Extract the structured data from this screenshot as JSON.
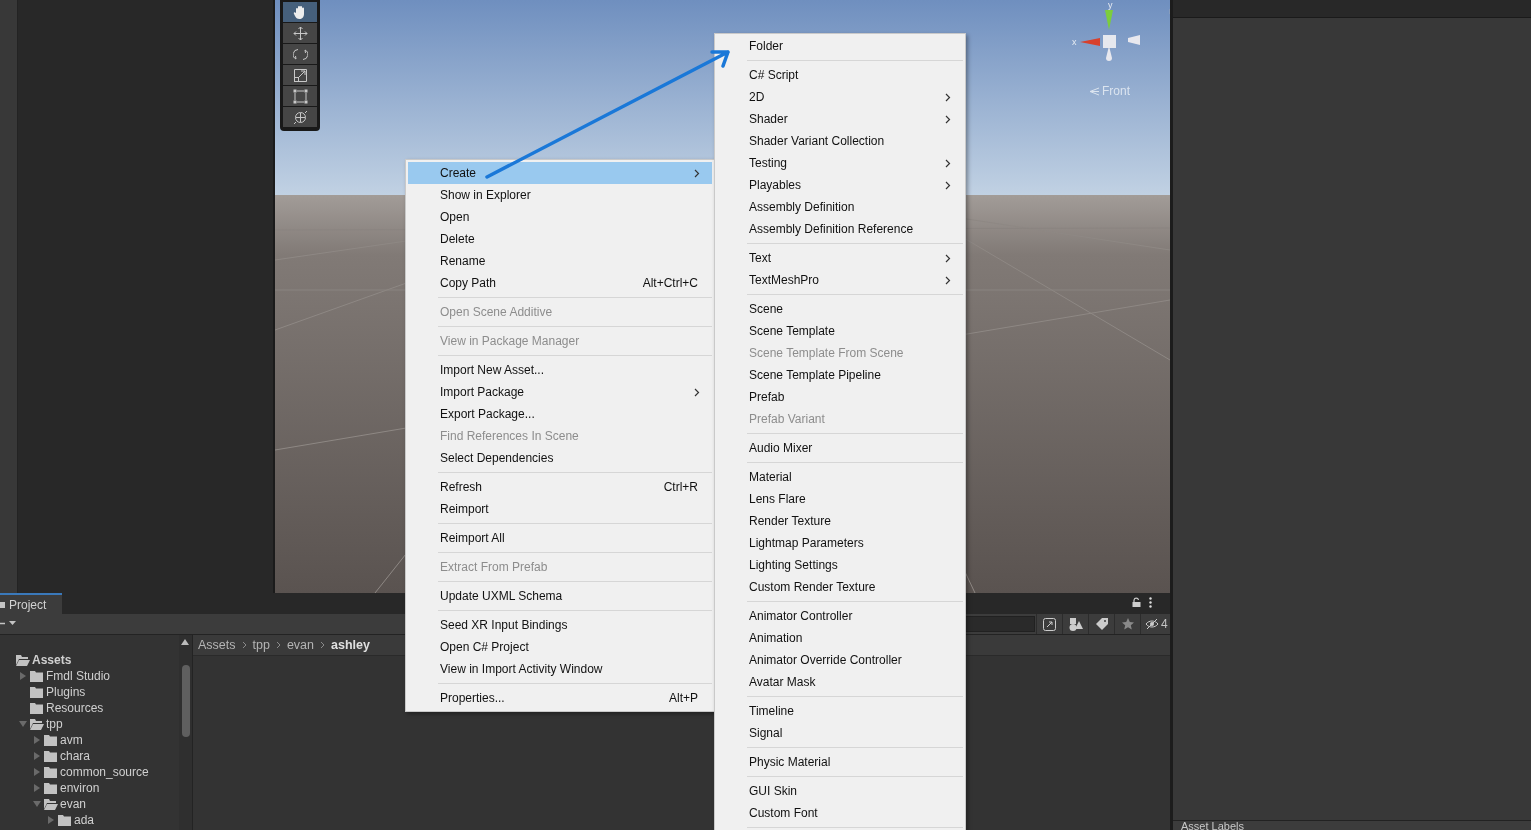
{
  "scene_toolbar": {
    "tools": [
      {
        "kind": "hand",
        "selected": true
      },
      {
        "kind": "move",
        "selected": false
      },
      {
        "kind": "rotate",
        "selected": false
      },
      {
        "kind": "scale",
        "selected": false
      },
      {
        "kind": "rect",
        "selected": false
      },
      {
        "kind": "transform",
        "selected": false
      }
    ]
  },
  "scene_gizmo": {
    "y_label": "y",
    "x_label": "x",
    "view_label": "Front"
  },
  "project_panel": {
    "tabs": [
      {
        "label": "Project",
        "selected": true
      }
    ],
    "item_count": "4",
    "tree": [
      {
        "label": "Assets",
        "kind": "root",
        "expanded": true,
        "children": [
          {
            "label": "Fmdl Studio",
            "kind": "branch",
            "expanded": false
          },
          {
            "label": "Plugins",
            "kind": "leaf",
            "expanded": false
          },
          {
            "label": "Resources",
            "kind": "leaf",
            "expanded": false
          },
          {
            "label": "tpp",
            "kind": "branch",
            "expanded": true,
            "children": [
              {
                "label": "avm",
                "kind": "branch",
                "expanded": false
              },
              {
                "label": "chara",
                "kind": "branch",
                "expanded": false
              },
              {
                "label": "common_source",
                "kind": "branch",
                "expanded": false
              },
              {
                "label": "environ",
                "kind": "branch",
                "expanded": false
              },
              {
                "label": "evan",
                "kind": "branch",
                "expanded": true,
                "children": [
                  {
                    "label": "ada",
                    "kind": "branch",
                    "expanded": false
                  }
                ]
              }
            ]
          }
        ]
      }
    ],
    "breadcrumb": [
      "Assets",
      "tpp",
      "evan",
      "ashley"
    ]
  },
  "inspector": {
    "section_label": "Asset Labels"
  },
  "context_menu": [
    {
      "kind": "item",
      "label": "Create",
      "submenu": true,
      "selected": true,
      "disabled": false
    },
    {
      "kind": "item",
      "label": "Show in Explorer",
      "submenu": false,
      "selected": false,
      "disabled": false
    },
    {
      "kind": "item",
      "label": "Open",
      "submenu": false,
      "selected": false,
      "disabled": false
    },
    {
      "kind": "item",
      "label": "Delete",
      "submenu": false,
      "selected": false,
      "disabled": false
    },
    {
      "kind": "item",
      "label": "Rename",
      "submenu": false,
      "selected": false,
      "disabled": false
    },
    {
      "kind": "item",
      "label": "Copy Path",
      "shortcut": "Alt+Ctrl+C",
      "submenu": false,
      "selected": false,
      "disabled": false
    },
    {
      "kind": "separator"
    },
    {
      "kind": "item",
      "label": "Open Scene Additive",
      "submenu": false,
      "selected": false,
      "disabled": true
    },
    {
      "kind": "separator"
    },
    {
      "kind": "item",
      "label": "View in Package Manager",
      "submenu": false,
      "selected": false,
      "disabled": true
    },
    {
      "kind": "separator"
    },
    {
      "kind": "item",
      "label": "Import New Asset...",
      "submenu": false,
      "selected": false,
      "disabled": false
    },
    {
      "kind": "item",
      "label": "Import Package",
      "submenu": true,
      "selected": false,
      "disabled": false
    },
    {
      "kind": "item",
      "label": "Export Package...",
      "submenu": false,
      "selected": false,
      "disabled": false
    },
    {
      "kind": "item",
      "label": "Find References In Scene",
      "submenu": false,
      "selected": false,
      "disabled": true
    },
    {
      "kind": "item",
      "label": "Select Dependencies",
      "submenu": false,
      "selected": false,
      "disabled": false
    },
    {
      "kind": "separator"
    },
    {
      "kind": "item",
      "label": "Refresh",
      "shortcut": "Ctrl+R",
      "submenu": false,
      "selected": false,
      "disabled": false
    },
    {
      "kind": "item",
      "label": "Reimport",
      "submenu": false,
      "selected": false,
      "disabled": false
    },
    {
      "kind": "separator"
    },
    {
      "kind": "item",
      "label": "Reimport All",
      "submenu": false,
      "selected": false,
      "disabled": false
    },
    {
      "kind": "separator"
    },
    {
      "kind": "item",
      "label": "Extract From Prefab",
      "submenu": false,
      "selected": false,
      "disabled": true
    },
    {
      "kind": "separator"
    },
    {
      "kind": "item",
      "label": "Update UXML Schema",
      "submenu": false,
      "selected": false,
      "disabled": false
    },
    {
      "kind": "separator"
    },
    {
      "kind": "item",
      "label": "Seed XR Input Bindings",
      "submenu": false,
      "selected": false,
      "disabled": false
    },
    {
      "kind": "item",
      "label": "Open C# Project",
      "submenu": false,
      "selected": false,
      "disabled": false
    },
    {
      "kind": "item",
      "label": "View in Import Activity Window",
      "submenu": false,
      "selected": false,
      "disabled": false
    },
    {
      "kind": "separator"
    },
    {
      "kind": "item",
      "label": "Properties...",
      "shortcut": "Alt+P",
      "submenu": false,
      "selected": false,
      "disabled": false
    }
  ],
  "create_submenu": [
    {
      "kind": "item",
      "label": "Folder",
      "submenu": false,
      "disabled": false
    },
    {
      "kind": "separator"
    },
    {
      "kind": "item",
      "label": "C# Script",
      "submenu": false,
      "disabled": false
    },
    {
      "kind": "item",
      "label": "2D",
      "submenu": true,
      "disabled": false
    },
    {
      "kind": "item",
      "label": "Shader",
      "submenu": true,
      "disabled": false
    },
    {
      "kind": "item",
      "label": "Shader Variant Collection",
      "submenu": false,
      "disabled": false
    },
    {
      "kind": "item",
      "label": "Testing",
      "submenu": true,
      "disabled": false
    },
    {
      "kind": "item",
      "label": "Playables",
      "submenu": true,
      "disabled": false
    },
    {
      "kind": "item",
      "label": "Assembly Definition",
      "submenu": false,
      "disabled": false
    },
    {
      "kind": "item",
      "label": "Assembly Definition Reference",
      "submenu": false,
      "disabled": false
    },
    {
      "kind": "separator"
    },
    {
      "kind": "item",
      "label": "Text",
      "submenu": true,
      "disabled": false
    },
    {
      "kind": "item",
      "label": "TextMeshPro",
      "submenu": true,
      "disabled": false
    },
    {
      "kind": "separator"
    },
    {
      "kind": "item",
      "label": "Scene",
      "submenu": false,
      "disabled": false
    },
    {
      "kind": "item",
      "label": "Scene Template",
      "submenu": false,
      "disabled": false
    },
    {
      "kind": "item",
      "label": "Scene Template From Scene",
      "submenu": false,
      "disabled": true
    },
    {
      "kind": "item",
      "label": "Scene Template Pipeline",
      "submenu": false,
      "disabled": false
    },
    {
      "kind": "item",
      "label": "Prefab",
      "submenu": false,
      "disabled": false
    },
    {
      "kind": "item",
      "label": "Prefab Variant",
      "submenu": false,
      "disabled": true
    },
    {
      "kind": "separator"
    },
    {
      "kind": "item",
      "label": "Audio Mixer",
      "submenu": false,
      "disabled": false
    },
    {
      "kind": "separator"
    },
    {
      "kind": "item",
      "label": "Material",
      "submenu": false,
      "disabled": false
    },
    {
      "kind": "item",
      "label": "Lens Flare",
      "submenu": false,
      "disabled": false
    },
    {
      "kind": "item",
      "label": "Render Texture",
      "submenu": false,
      "disabled": false
    },
    {
      "kind": "item",
      "label": "Lightmap Parameters",
      "submenu": false,
      "disabled": false
    },
    {
      "kind": "item",
      "label": "Lighting Settings",
      "submenu": false,
      "disabled": false
    },
    {
      "kind": "item",
      "label": "Custom Render Texture",
      "submenu": false,
      "disabled": false
    },
    {
      "kind": "separator"
    },
    {
      "kind": "item",
      "label": "Animator Controller",
      "submenu": false,
      "disabled": false
    },
    {
      "kind": "item",
      "label": "Animation",
      "submenu": false,
      "disabled": false
    },
    {
      "kind": "item",
      "label": "Animator Override Controller",
      "submenu": false,
      "disabled": false
    },
    {
      "kind": "item",
      "label": "Avatar Mask",
      "submenu": false,
      "disabled": false
    },
    {
      "kind": "separator"
    },
    {
      "kind": "item",
      "label": "Timeline",
      "submenu": false,
      "disabled": false
    },
    {
      "kind": "item",
      "label": "Signal",
      "submenu": false,
      "disabled": false
    },
    {
      "kind": "separator"
    },
    {
      "kind": "item",
      "label": "Physic Material",
      "submenu": false,
      "disabled": false
    },
    {
      "kind": "separator"
    },
    {
      "kind": "item",
      "label": "GUI Skin",
      "submenu": false,
      "disabled": false
    },
    {
      "kind": "item",
      "label": "Custom Font",
      "submenu": false,
      "disabled": false
    },
    {
      "kind": "separator"
    }
  ]
}
